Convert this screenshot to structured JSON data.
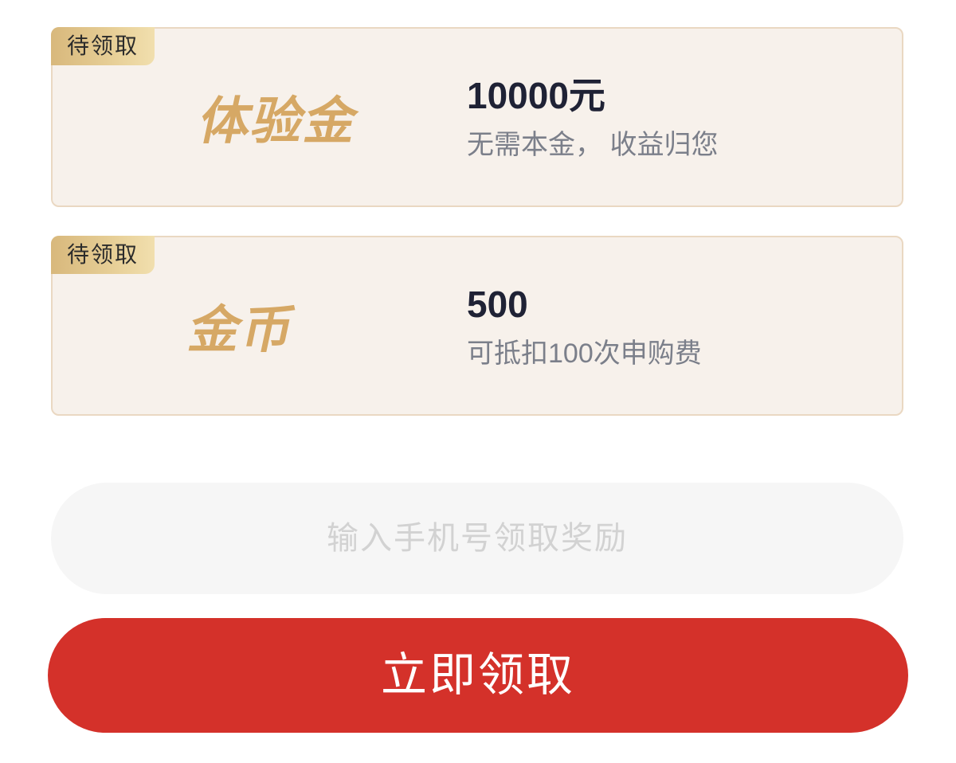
{
  "rewards": [
    {
      "badge": "待领取",
      "title": "体验金",
      "amount": "10000元",
      "description": "无需本金， 收益归您"
    },
    {
      "badge": "待领取",
      "title": "金币",
      "amount": "500",
      "description": "可抵扣100次申购费"
    }
  ],
  "phone_input": {
    "placeholder": "输入手机号领取奖励",
    "value": ""
  },
  "claim_button": {
    "label": "立即领取"
  },
  "colors": {
    "card_background": "#f7f1eb",
    "card_border": "#ead8c2",
    "title_gold": "#d6a865",
    "badge_gold": "#e7cf97",
    "button_red": "#d4312a",
    "amount_text": "#1f2235",
    "description_text": "#7b7f8a",
    "input_background": "#f6f6f6",
    "placeholder_text": "#d2d2d2"
  }
}
